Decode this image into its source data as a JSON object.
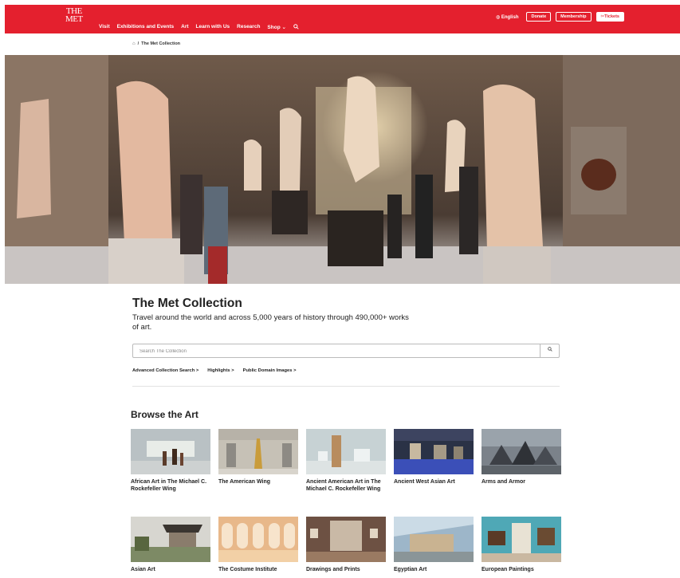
{
  "header": {
    "logo_line1": "THE",
    "logo_line2": "MET",
    "nav": [
      "Visit",
      "Exhibitions and Events",
      "Art",
      "Learn with Us",
      "Research",
      "Shop"
    ],
    "shop_caret": "⌄",
    "search_icon": "search-icon",
    "language": "English",
    "donate": "Donate",
    "membership": "Membership",
    "tickets": "Tickets",
    "brand_color": "#e4202e"
  },
  "breadcrumb": {
    "separator": "/",
    "current": "The Met Collection"
  },
  "intro": {
    "title": "The Met Collection",
    "description": "Travel around the world and across 5,000 years of history through 490,000+ works of art."
  },
  "search": {
    "placeholder": "Search The Collection",
    "value": ""
  },
  "quicklinks": [
    "Advanced Collection Search  >",
    "Highlights  >",
    "Public Domain Images  >"
  ],
  "browse": {
    "title": "Browse the Art",
    "cards": [
      "African Art in The Michael C. Rockefeller Wing",
      "The American Wing",
      "Ancient American Art in The Michael C. Rockefeller Wing",
      "Ancient West Asian Art",
      "Arms and Armor",
      "Asian Art",
      "The Costume Institute",
      "Drawings and Prints",
      "Egyptian Art",
      "European Paintings"
    ]
  }
}
